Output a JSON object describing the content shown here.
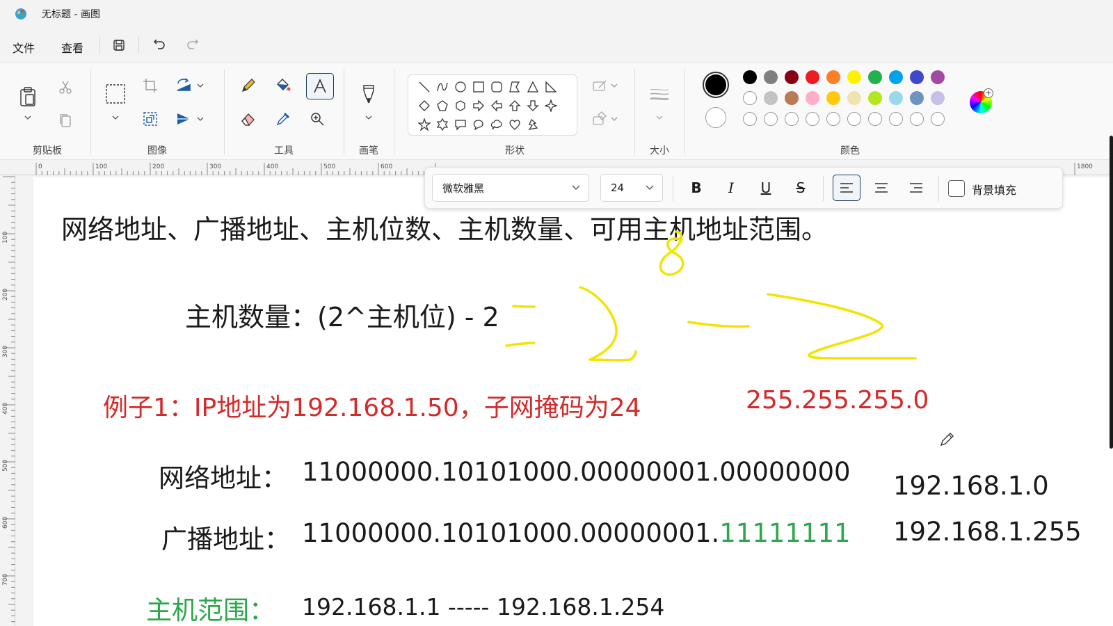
{
  "window": {
    "title": "无标题 - 画图"
  },
  "menu": {
    "file": "文件",
    "view": "查看"
  },
  "ribbon": {
    "groups": {
      "clipboard": "剪贴板",
      "image": "图像",
      "tools": "工具",
      "brushes": "画笔",
      "shapes": "形状",
      "size": "大小",
      "colors": "颜色"
    },
    "palette_row1": [
      "#000000",
      "#7f7f7f",
      "#880015",
      "#ed1c24",
      "#ff7f27",
      "#fff200",
      "#22b14c",
      "#00a2e8",
      "#3f48cc",
      "#a349a4"
    ],
    "palette_row2": [
      "#ffffff",
      "#c3c3c3",
      "#b97a57",
      "#ffaec9",
      "#ffc90e",
      "#efe4b0",
      "#b5e61d",
      "#99d9ea",
      "#7092be",
      "#c8bfe7"
    ],
    "color1": "#000000",
    "color2": "#ffffff"
  },
  "ruler": {
    "h_labels": [
      "0",
      "100",
      "200",
      "300",
      "400",
      "500",
      "600",
      "1800"
    ],
    "v_labels": [
      "100",
      "200",
      "300",
      "400",
      "500",
      "600",
      "700"
    ]
  },
  "text_toolbar": {
    "font": "微软雅黑",
    "size": "24",
    "bold": "B",
    "italic": "I",
    "underline": "U",
    "strike": "S",
    "bg_fill_label": "背景填充"
  },
  "canvas": {
    "line_title": "网络地址、广播地址、主机位数、主机数量、可用主机地址范围。",
    "line_formula": "主机数量：(2^主机位) - 2",
    "line_example": "例子1：IP地址为192.168.1.50，子网掩码为24",
    "mask": "255.255.255.0",
    "net_label": "网络地址：",
    "net_bin": "11000000.10101000.00000001.00000000",
    "net_dec": "192.168.1.0",
    "bc_label": "广播地址：",
    "bc_bin_prefix": "11000000.10101000.00000001.",
    "bc_bin_host": "11111111",
    "bc_dec": "192.168.1.255",
    "host_label": "主机范围：",
    "host_range": "192.168.1.1 ----- 192.168.1.254",
    "colors": {
      "red": "#d42a2a",
      "green": "#2aa84a",
      "yellow": "#f2e400"
    }
  }
}
